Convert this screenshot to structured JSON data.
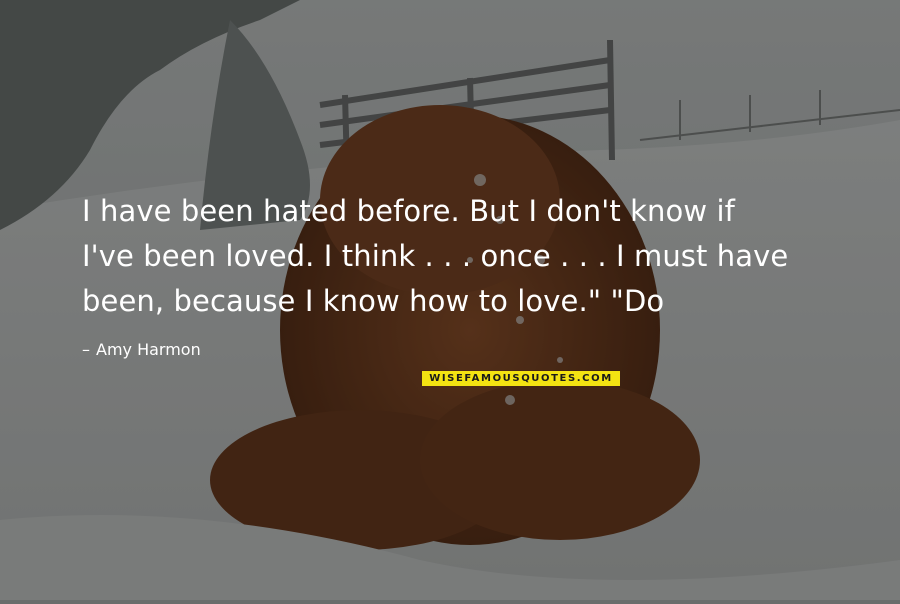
{
  "quote": {
    "lines": [
      "I have been hated before. But I don't know if",
      "I've been loved. I think . . . once . . . I must have",
      "been, because I know how to love.\" \"Do"
    ]
  },
  "author": {
    "dash": "–",
    "name": "Amy Harmon"
  },
  "logo": {
    "text": "WISEFAMOUSQUOTES.COM"
  },
  "colors": {
    "text": "#ffffff",
    "logo_bg": "#f3e312"
  }
}
